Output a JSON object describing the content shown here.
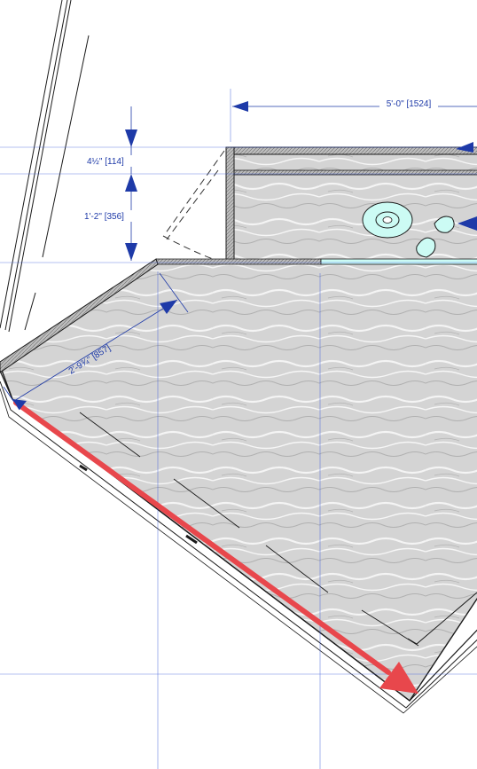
{
  "dimensions": {
    "width_top": "5'-0\"  [1524]",
    "height_upper": "4½\"  [114]",
    "height_lower": "1'-2\"  [356]",
    "diagonal": "2'-9¾\"  [857]"
  },
  "colors": {
    "dimension_blue": "#1e3aa8",
    "guide_blue": "#3b5bdb",
    "direction_arrow_red": "#e8474c",
    "fixture_fill": "#ccfbf4",
    "water_fill": "#d6d6d6"
  },
  "icons": {
    "direction_arrow": "red-arrow-icon",
    "dimension_arrow": "blue-arrowhead-icon"
  }
}
